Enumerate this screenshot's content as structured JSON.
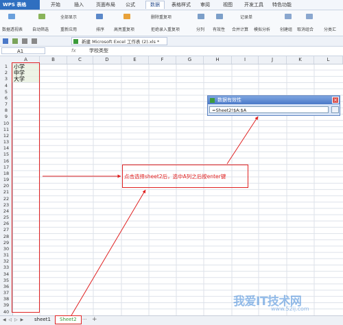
{
  "app": {
    "logo": "WPS 表格"
  },
  "menu": {
    "tabs": [
      {
        "label": "开始"
      },
      {
        "label": "插入"
      },
      {
        "label": "页面布局"
      },
      {
        "label": "公式"
      },
      {
        "label": "数据"
      },
      {
        "label": "表格样式"
      },
      {
        "label": "审阅"
      },
      {
        "label": "视图"
      },
      {
        "label": "开发工具"
      },
      {
        "label": "特色功能"
      }
    ],
    "active": "数据"
  },
  "ribbon": {
    "items": [
      {
        "label": "数据透视表"
      },
      {
        "label": "自动筛选"
      },
      {
        "label": "全部显示"
      },
      {
        "label": "重新应用"
      },
      {
        "label": "排序"
      },
      {
        "label": "高亮重复项"
      },
      {
        "label": "删除重复项"
      },
      {
        "label": "拒绝录入重复项"
      },
      {
        "label": "分列"
      },
      {
        "label": "有效性"
      },
      {
        "label": "合并计算"
      },
      {
        "label": "记录单"
      },
      {
        "label": "模拟分析"
      },
      {
        "label": "创建组"
      },
      {
        "label": "取消组合"
      },
      {
        "label": "分类汇"
      }
    ]
  },
  "file_tab": {
    "label": "新建 Microsoft Excel 工作表 (2).xls *"
  },
  "formula_bar": {
    "name_box": "A1",
    "fx": "fx",
    "content": "学校类型"
  },
  "columns": [
    "A",
    "B",
    "C",
    "D",
    "E",
    "F",
    "G",
    "H",
    "I",
    "J",
    "K",
    "L"
  ],
  "rows": [
    "1",
    "2",
    "3",
    "4",
    "5",
    "6",
    "7",
    "8",
    "9",
    "10",
    "11",
    "12",
    "13",
    "14",
    "15",
    "16",
    "17",
    "18",
    "19",
    "20",
    "21",
    "22",
    "23",
    "24",
    "25",
    "26",
    "27",
    "28",
    "29",
    "30",
    "31",
    "32",
    "33",
    "34",
    "35",
    "36",
    "37",
    "38",
    "39",
    "40"
  ],
  "cells": {
    "A1": "小学",
    "A2": "中学",
    "A3": "大学"
  },
  "sheet_tabs": [
    {
      "label": "sheet1"
    },
    {
      "label": "Sheet2"
    }
  ],
  "dialog": {
    "title": "数据有效性",
    "value": "=Sheet2!$A:$A",
    "close": "×"
  },
  "annotation": {
    "text": "点击选择sheet2后，选中A列之后按enter键"
  },
  "watermark": {
    "text": "我爱IT技术网",
    "url": "www.52ij.com"
  },
  "colors": {
    "annotation": "#e02020",
    "wps_blue": "#2f6fc0",
    "dialog_title": "#4a78c8"
  }
}
